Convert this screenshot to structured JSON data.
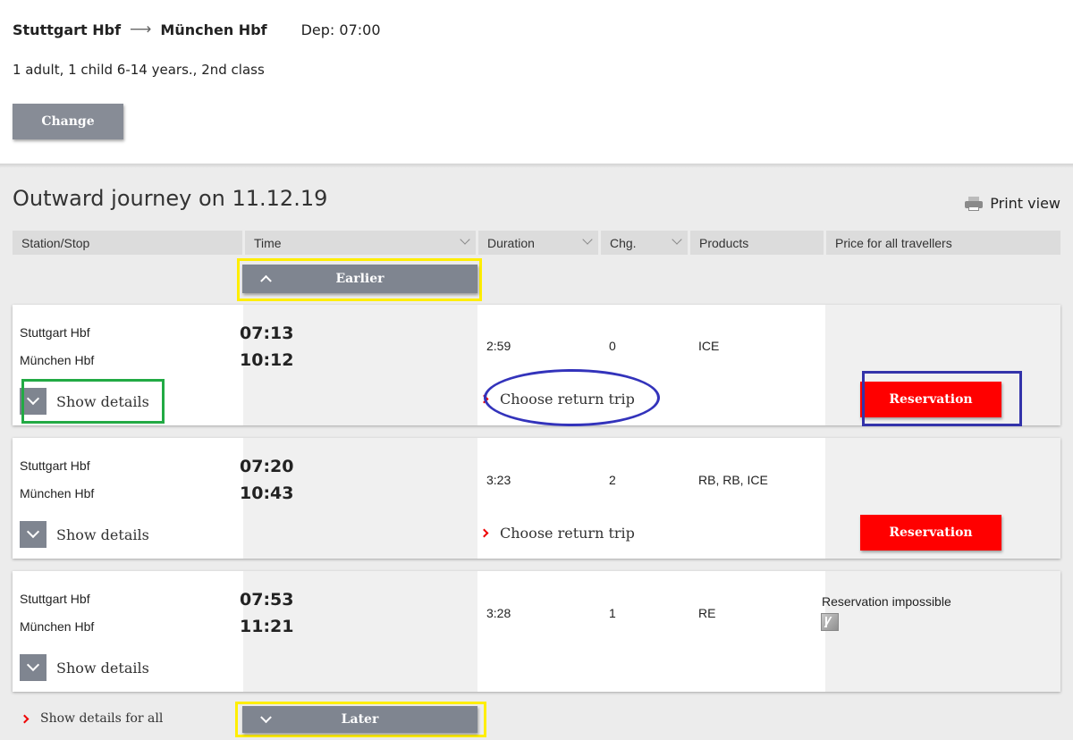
{
  "header": {
    "from": "Stuttgart Hbf",
    "to": "München Hbf",
    "departure": "Dep: 07:00",
    "travellers": "1 adult, 1 child 6-14 years., 2nd class",
    "change_label": "Change"
  },
  "journey": {
    "title": "Outward journey on 11.12.19",
    "print_label": "Print view"
  },
  "columns": {
    "station": "Station/Stop",
    "time": "Time",
    "duration": "Duration",
    "changes": "Chg.",
    "products": "Products",
    "price": "Price for all travellers"
  },
  "earlier_label": "Earlier",
  "later_label": "Later",
  "show_details_all": "Show details for all",
  "connections": [
    {
      "from": "Stuttgart Hbf",
      "to": "München Hbf",
      "dep": "07:13",
      "arr": "10:12",
      "duration": "2:59",
      "changes": "0",
      "products": "ICE",
      "details_label": "Show details",
      "return_label": "Choose return trip",
      "reservation_label": "Reservation"
    },
    {
      "from": "Stuttgart Hbf",
      "to": "München Hbf",
      "dep": "07:20",
      "arr": "10:43",
      "duration": "3:23",
      "changes": "2",
      "products": "RB, RB, ICE",
      "details_label": "Show details",
      "return_label": "Choose return trip",
      "reservation_label": "Reservation"
    },
    {
      "from": "Stuttgart Hbf",
      "to": "München Hbf",
      "dep": "07:53",
      "arr": "11:21",
      "duration": "3:28",
      "changes": "1",
      "products": "RE",
      "details_label": "Show details",
      "reservation_note": "Reservation impossible"
    }
  ],
  "colors": {
    "reservation_red": "#ff0000",
    "button_gray": "#7f8590",
    "highlight_yellow": "#ffee00",
    "highlight_green": "#22aa44",
    "highlight_blue": "#3333aa"
  }
}
